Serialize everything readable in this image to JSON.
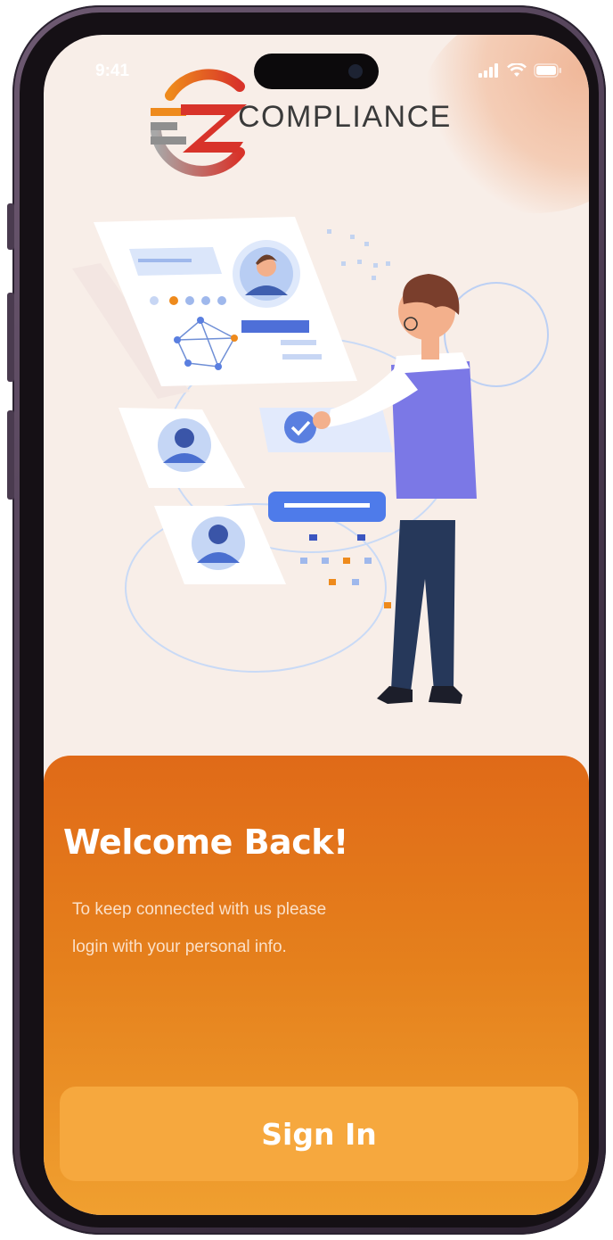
{
  "status_bar": {
    "time": "9:41",
    "icons": [
      "cellular-signal-icon",
      "wifi-icon",
      "battery-icon"
    ]
  },
  "logo": {
    "wordmark": "COMPLIANCE",
    "colors": {
      "red": "#d8332a",
      "orange": "#ee8a1c",
      "gray": "#9a9a9a"
    }
  },
  "welcome": {
    "title": "Welcome Back!",
    "line1": "To keep connected with us please",
    "line2": "login with your personal info."
  },
  "sign_in": {
    "label": "Sign In"
  },
  "colors": {
    "accent": "#e5801c",
    "button": "#f6a83e",
    "background": "#f8eee8",
    "illustration_blue": "#5a7fe0",
    "illustration_purple": "#7a7ae6"
  }
}
